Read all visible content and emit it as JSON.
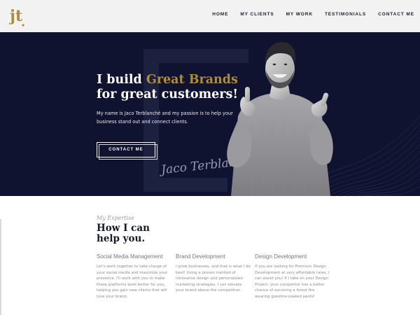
{
  "logo": {
    "text": "jt",
    "color": "#b08b3c"
  },
  "nav": {
    "items": [
      {
        "label": "HOME"
      },
      {
        "label": "MY CLIENTS"
      },
      {
        "label": "MY WORK"
      },
      {
        "label": "TESTIMONIALS"
      },
      {
        "label": "CONTACT ME"
      }
    ]
  },
  "hero": {
    "headline_pre": "I build ",
    "headline_accent": "Great Brands",
    "headline_line2": "for great customers!",
    "text": "My name is Jaco Terblanché and my passion is to help your business stand out and connect clients.",
    "cta_label": "CONTACT ME",
    "signature": "Jaco Terblanché",
    "background_color": "#0f1330",
    "accent_color": "#b08b3c"
  },
  "expertise": {
    "eyebrow": "My Expertise",
    "title": "How I can help you.",
    "columns": [
      {
        "title": "Social Media Management",
        "text": "Let's work together to take charge of your social media and maximize your presence. I'll work with you to make these platforms work better for you, helping you gain new clients that will love your brand."
      },
      {
        "title": "Brand Development",
        "text": "I grow businesses, and that is what I do best! Using a proven method of innovative design and personalized marketing strategies, I can elevate your brand above the competition."
      },
      {
        "title": "Design Development",
        "text": "If you are looking for Premium Design Development at very affordable rates, I can assist you! If I take on your Design Project, your competitor has a better chance of surviving a forest fire wearing gasoline-soaked pants!"
      }
    ]
  }
}
